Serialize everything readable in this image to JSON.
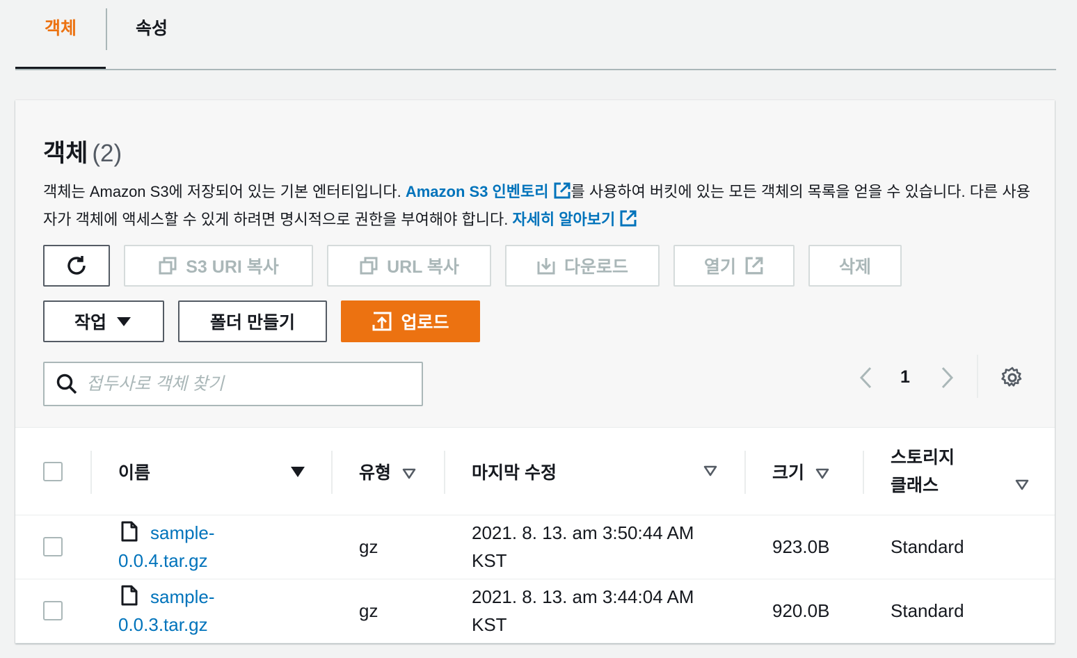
{
  "tabs": [
    {
      "label": "객체",
      "active": true
    },
    {
      "label": "속성",
      "active": false
    }
  ],
  "panel": {
    "title": "객체",
    "count": "(2)",
    "description_part1": "객체는 Amazon S3에 저장되어 있는 기본 엔터티입니다. ",
    "inventory_link": "Amazon S3 인벤토리",
    "description_part2": "를 사용하여 버킷에 있는 모든 객체의 목록을 얻을 수 있습니다. 다른 사용자가 객체에 액세스할 수 있게 하려면 명시적으로 권한을 부여해야 합니다. ",
    "learn_more_link": "자세히 알아보기"
  },
  "actions": {
    "copy_s3_uri": "S3 URI 복사",
    "copy_url": "URL 복사",
    "download": "다운로드",
    "open": "열기",
    "delete": "삭제",
    "actions_menu": "작업",
    "create_folder": "폴더 만들기",
    "upload": "업로드"
  },
  "search": {
    "placeholder": "접두사로 객체 찾기"
  },
  "pagination": {
    "current_page": "1"
  },
  "table": {
    "columns": {
      "name": "이름",
      "type": "유형",
      "last_modified": "마지막 수정",
      "size": "크기",
      "storage_class_line1": "스토리지",
      "storage_class_line2": "클래스"
    },
    "rows": [
      {
        "name_line1": "sample-",
        "name_line2": "0.0.4.tar.gz",
        "type": "gz",
        "modified_line1": "2021. 8. 13. am 3:50:44 AM",
        "modified_line2": "KST",
        "size": "923.0B",
        "storage_class": "Standard"
      },
      {
        "name_line1": "sample-",
        "name_line2": "0.0.3.tar.gz",
        "type": "gz",
        "modified_line1": "2021. 8. 13. am 3:44:04 AM",
        "modified_line2": "KST",
        "size": "920.0B",
        "storage_class": "Standard"
      }
    ]
  },
  "colors": {
    "accent": "#ec7211",
    "link": "#0073bb",
    "text": "#16191f",
    "disabled": "#aab7b8"
  }
}
